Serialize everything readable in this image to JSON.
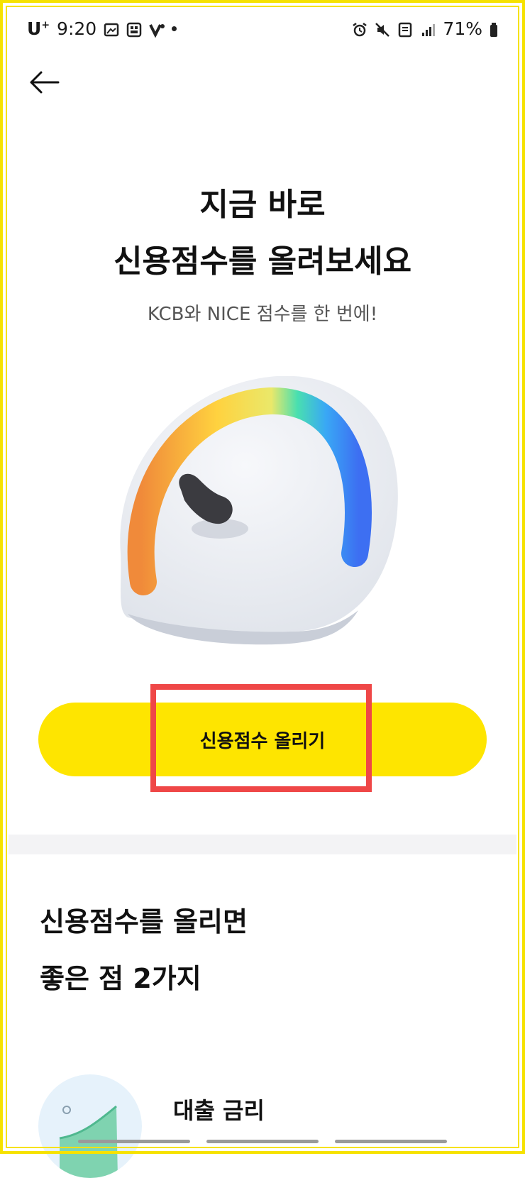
{
  "status_bar": {
    "carrier": "U",
    "carrier_sup": "+",
    "time": "9:20",
    "battery": "71%"
  },
  "header": {
    "title_line1": "지금 바로",
    "title_line2": "신용점수를 올려보세요",
    "subtitle": "KCB와 NICE 점수를 한 번에!"
  },
  "cta": {
    "label": "신용점수 올리기"
  },
  "benefits": {
    "title_line1": "신용점수를 올리면",
    "title_line2": "좋은 점 2가지",
    "items": [
      {
        "label": "대출 금리"
      }
    ]
  },
  "colors": {
    "accent": "#fee500",
    "highlight": "#ef4747",
    "frame": "#f6e200"
  },
  "icons": [
    "back-arrow-icon",
    "gauge-illustration",
    "loan-rate-illustration"
  ]
}
